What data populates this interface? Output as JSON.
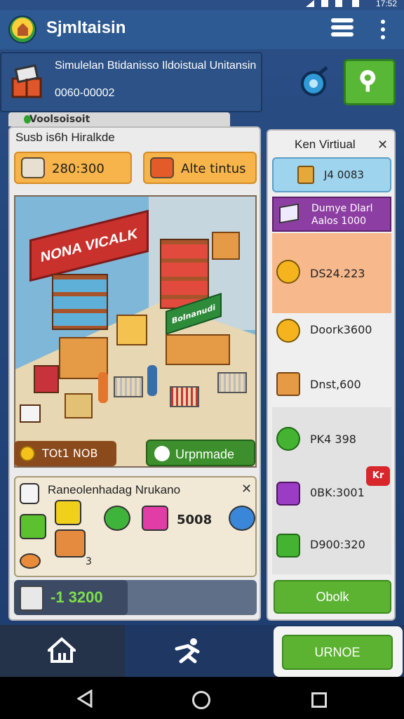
{
  "status_bar": {
    "time": "17:52"
  },
  "app_bar": {
    "title": "Sjmltaisin"
  },
  "sim_header": {
    "title": "Simulelan Btidanisso Ildoistual Unitansin",
    "subtitle": "0060-00002"
  },
  "left_panel": {
    "balance_tag": "Voolsoisoit",
    "section_title": "Susb is6h Hiralkde",
    "stat_1": "280:300",
    "stat_2": "Alte tintus",
    "store_sign": "NONA VICALK",
    "counter_sign": "Bolnanudi",
    "total_label": "TOt1 NOB",
    "upgrade_button": "Urpnmade",
    "inventory": {
      "title": "Raneolenhadag Nrukano",
      "count": "5008",
      "qty": "3"
    },
    "budget_value": "-1 3200"
  },
  "right_panel": {
    "title": "Ken Virtiual",
    "stat": "J4 0083",
    "banner": "Dumye Dlarl Aalos 1000",
    "rows": [
      {
        "value": "DS24.223",
        "icon": "coin-icon",
        "bg": "#f7b98c"
      },
      {
        "value": "Doork3600",
        "icon": "coin-icon",
        "bg": "#efefef"
      },
      {
        "value": "Dnst,600",
        "icon": "box-icon",
        "bg": "#efefef"
      },
      {
        "value": "PK4 398",
        "icon": "green-orb-icon",
        "bg": "#e2e2e2"
      },
      {
        "value": "0BK:3001",
        "icon": "purple-box-icon",
        "bg": "#e2e2e2"
      },
      {
        "value": "D900:320",
        "icon": "green-box-icon",
        "bg": "#e2e2e2"
      }
    ],
    "badge": "Kr",
    "open_button": "Obolk"
  },
  "bottom_nav": {
    "upgrade_button": "URNOE"
  },
  "colors": {
    "accent_green": "#5cb332",
    "header_blue": "#2d5a92",
    "warning_red": "#d8262d"
  }
}
